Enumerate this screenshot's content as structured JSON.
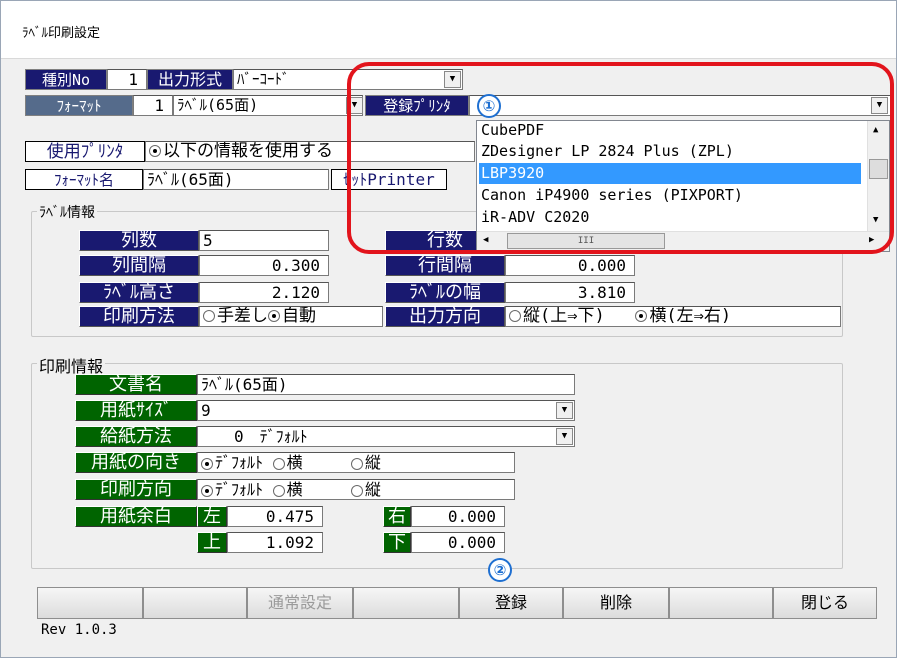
{
  "window": {
    "title": "ﾗﾍﾞﾙ印刷設定"
  },
  "top": {
    "kind_label": "種別No",
    "kind_value": "1",
    "output_label": "出力形式",
    "output_value": "ﾊﾞｰｺｰﾄﾞ",
    "format_label": "ﾌｫｰﾏｯﾄ",
    "format_no": "1",
    "format_value": "ﾗﾍﾞﾙ(65面)",
    "reg_printer_label": "登録ﾌﾟﾘﾝﾀ",
    "use_printer_label": "使用ﾌﾟﾘﾝﾀ",
    "use_printer_option": "以下の情報を使用する",
    "format_name_label": "ﾌｫｰﾏｯﾄ名",
    "format_name_value": "ﾗﾍﾞﾙ(65面)",
    "set_printer_label": "ｾｯﾄPrinter"
  },
  "printer_list": {
    "items": [
      "CubePDF",
      "ZDesigner LP 2824 Plus (ZPL)",
      "LBP3920",
      "Canon iP4900 series (PIXPORT)",
      "iR-ADV C2020"
    ],
    "selected": "LBP3920",
    "scroll_marker": "III"
  },
  "label_info": {
    "legend": "ﾗﾍﾞﾙ情報",
    "cols_label": "列数",
    "cols_value": "5",
    "rows_label": "行数",
    "col_gap_label": "列間隔",
    "col_gap_value": "0.300",
    "row_gap_label": "行間隔",
    "row_gap_value": "0.000",
    "height_label": "ﾗﾍﾞﾙ高さ",
    "height_value": "2.120",
    "width_label": "ﾗﾍﾞﾙの幅",
    "width_value": "3.810",
    "method_label": "印刷方法",
    "method_manual": "手差し",
    "method_auto": "自動",
    "dir_label": "出力方向",
    "dir_vertical": "縦(上⇒下)",
    "dir_horizontal": "横(左⇒右)"
  },
  "print_info": {
    "legend": "印刷情報",
    "doc_label": "文書名",
    "doc_value": "ﾗﾍﾞﾙ(65面)",
    "paper_label": "用紙ｻｲｽﾞ",
    "paper_value": "9",
    "feed_label": "給紙方法",
    "feed_value": "0　ﾃﾞﾌｫﾙﾄ",
    "orient_label": "用紙の向き",
    "orient_default": "ﾃﾞﾌｫﾙﾄ",
    "orient_h": "横",
    "orient_v": "縦",
    "pdir_label": "印刷方向",
    "pdir_default": "ﾃﾞﾌｫﾙﾄ",
    "pdir_h": "横",
    "pdir_v": "縦",
    "margin_label": "用紙余白",
    "left_label": "左",
    "left_value": "0.475",
    "right_label": "右",
    "right_value": "0.000",
    "top_label": "上",
    "top_value": "1.092",
    "bottom_label": "下",
    "bottom_value": "0.000"
  },
  "buttons": {
    "normal": "通常設定",
    "register": "登録",
    "delete": "削除",
    "close": "閉じる"
  },
  "footer": {
    "rev": "Rev 1.0.3"
  },
  "callouts": {
    "one": "①",
    "two": "②"
  },
  "colors": {
    "label_bg": "#191970",
    "green_label_bg": "#006400",
    "selection": "#3399ff",
    "highlight_ring": "#e2141c",
    "callout": "#1e6fd1"
  }
}
